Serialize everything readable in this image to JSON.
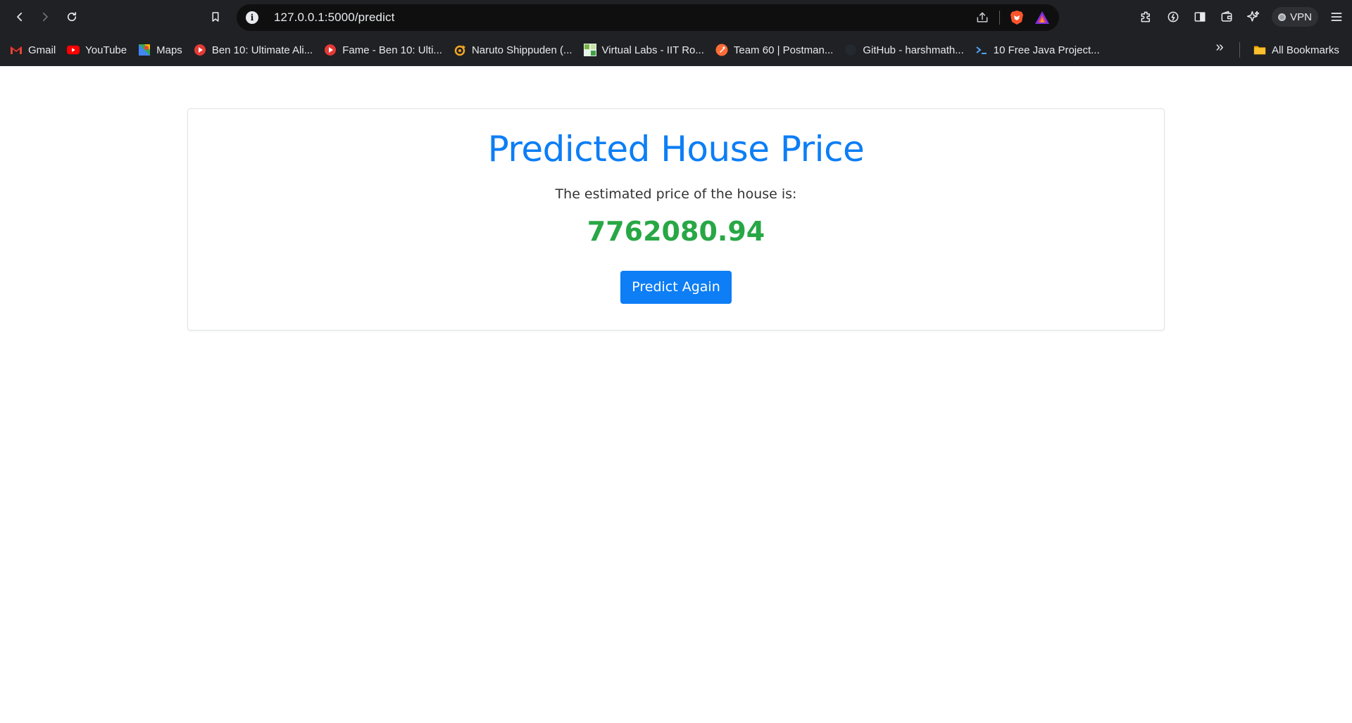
{
  "browser": {
    "url": "127.0.0.1:5000/predict",
    "vpn_label": "VPN"
  },
  "bookmarks": {
    "items": [
      {
        "label": "Gmail",
        "icon": "gmail-icon"
      },
      {
        "label": "YouTube",
        "icon": "youtube-icon"
      },
      {
        "label": "Maps",
        "icon": "maps-icon"
      },
      {
        "label": "Ben 10: Ultimate Ali...",
        "icon": "youtube-red-circle-icon"
      },
      {
        "label": "Fame - Ben 10: Ulti...",
        "icon": "youtube-red-circle-icon"
      },
      {
        "label": "Naruto Shippuden (...",
        "icon": "naruto-icon"
      },
      {
        "label": "Virtual Labs - IIT Ro...",
        "icon": "virtual-labs-icon"
      },
      {
        "label": "Team 60 | Postman...",
        "icon": "postman-icon"
      },
      {
        "label": "GitHub - harshmath...",
        "icon": "github-icon"
      },
      {
        "label": "10 Free Java Project...",
        "icon": "terminal-icon"
      }
    ],
    "all_bookmarks_label": "All Bookmarks"
  },
  "page": {
    "title": "Predicted House Price",
    "subtitle": "The estimated price of the house is:",
    "price": "7762080.94",
    "predict_again_label": "Predict Again"
  },
  "colors": {
    "title_blue": "#0d7ef5",
    "price_green": "#28a745",
    "button_blue": "#0d7ef5"
  }
}
